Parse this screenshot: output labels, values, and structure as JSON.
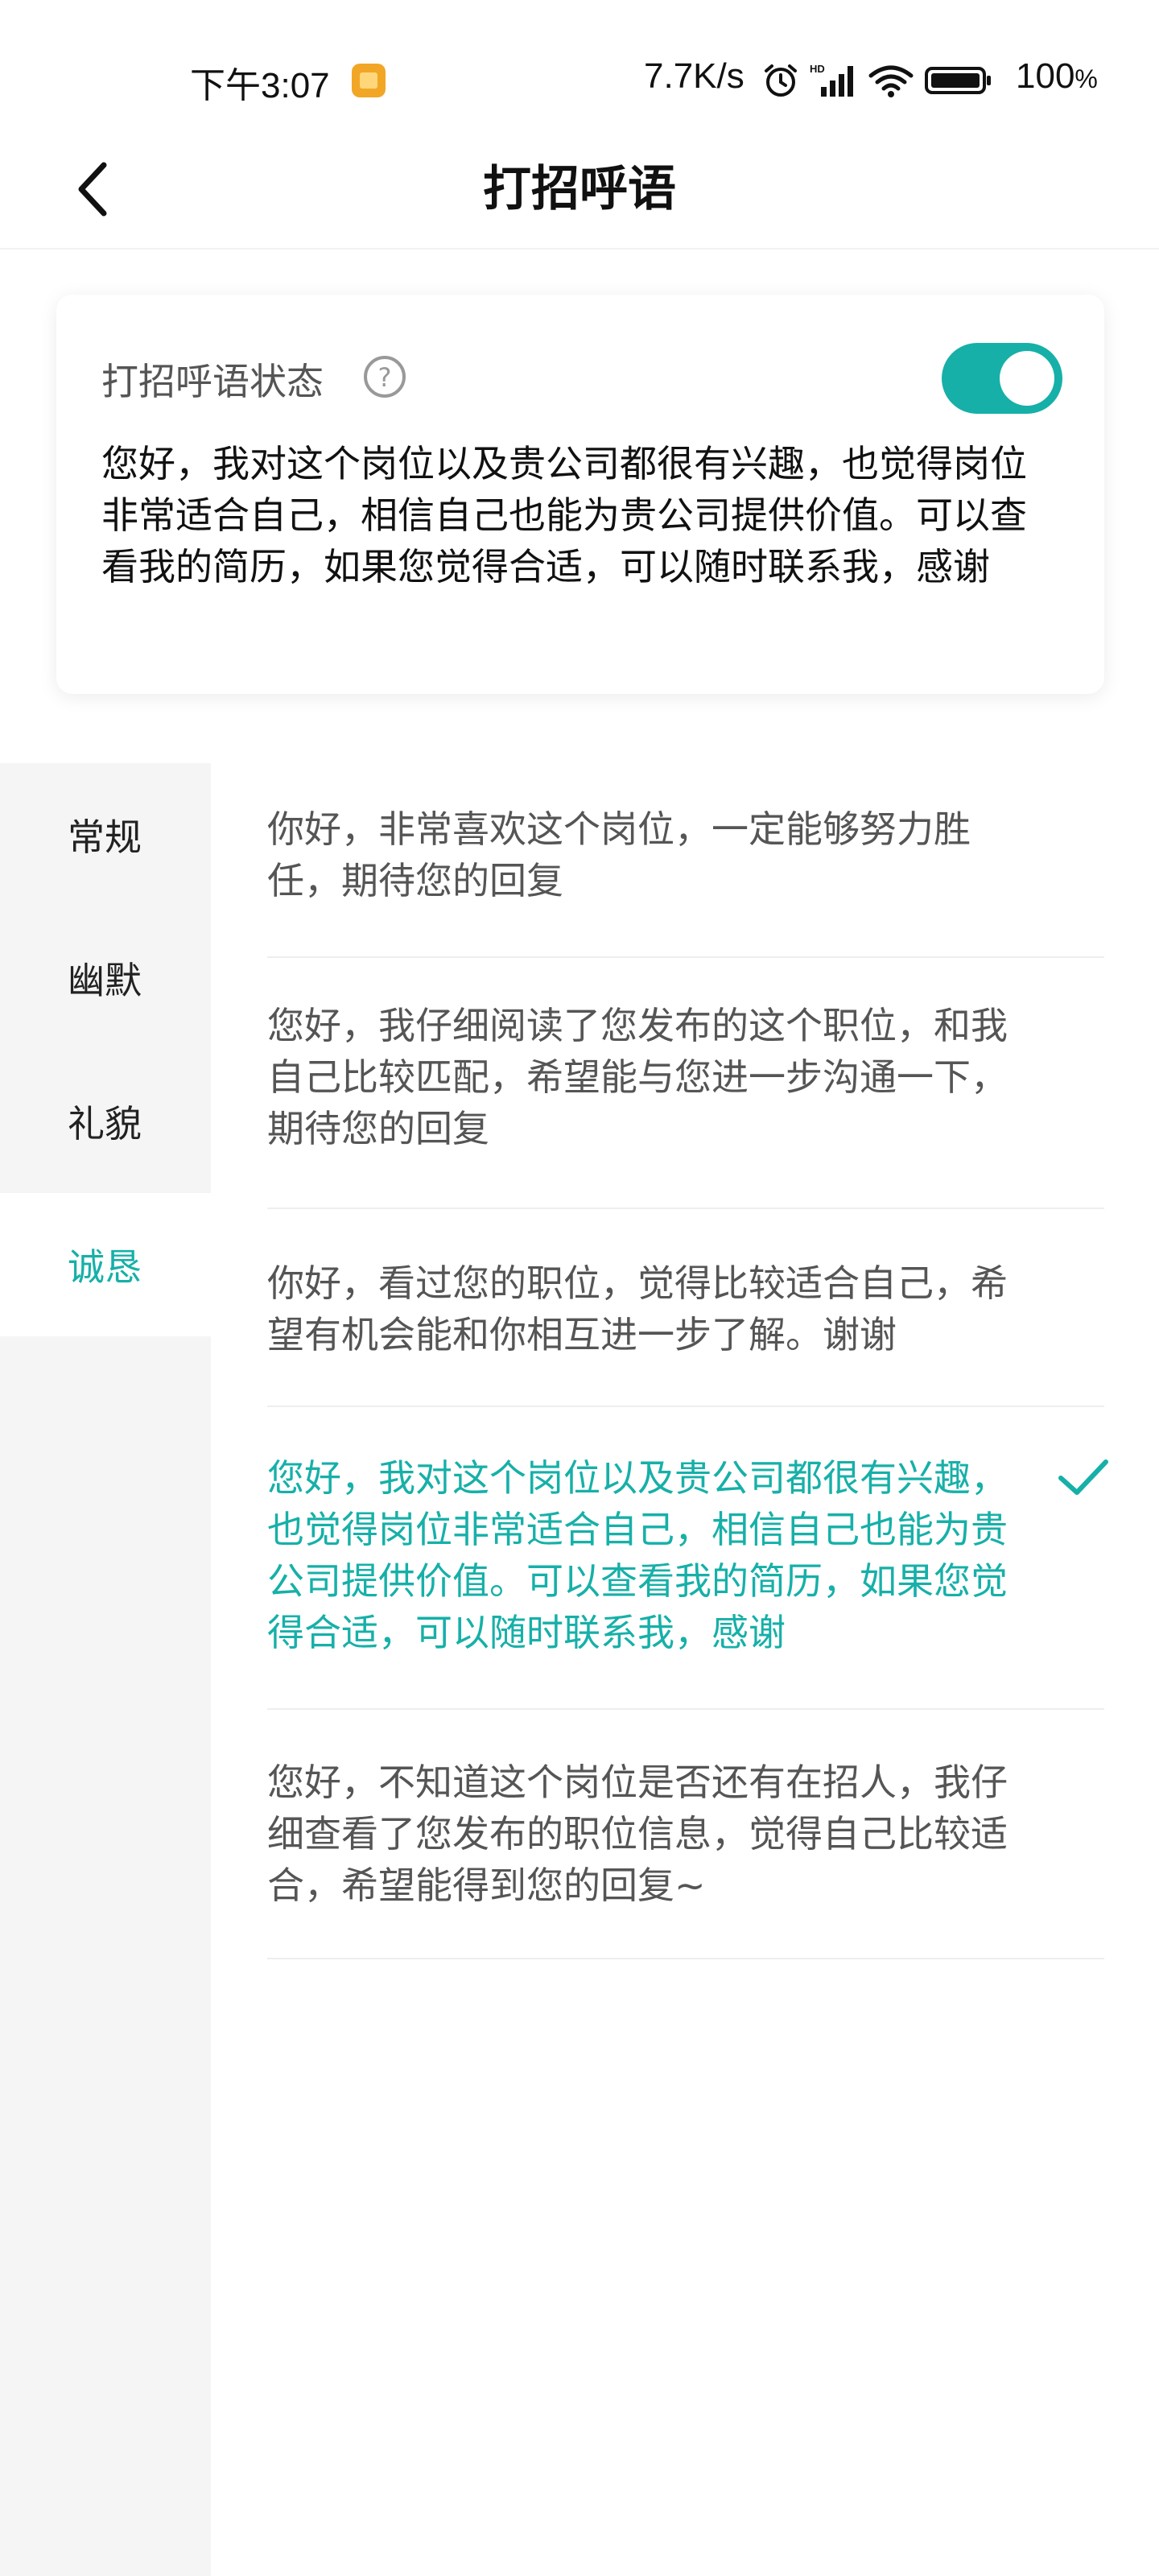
{
  "status_bar": {
    "time": "下午3:07",
    "net_speed": "7.7K/s",
    "battery": "100",
    "battery_unit": "%"
  },
  "header": {
    "title": "打招呼语"
  },
  "greeting_status": {
    "label": "打招呼语状态",
    "enabled": true,
    "current_text": "您好，我对这个岗位以及贵公司都很有兴趣，也觉得岗位非常适合自己，相信自己也能为贵公司提供价值。可以查看我的简历，如果您觉得合适，可以随时联系我，感谢"
  },
  "categories": [
    {
      "label": "常规"
    },
    {
      "label": "幽默"
    },
    {
      "label": "礼貌"
    },
    {
      "label": "诚恳",
      "active": true
    }
  ],
  "templates": [
    {
      "text": "你好，非常喜欢这个岗位，一定能够努力胜任，期待您的回复"
    },
    {
      "text": "您好，我仔细阅读了您发布的这个职位，和我自己比较匹配，希望能与您进一步沟通一下，期待您的回复"
    },
    {
      "text": "你好，看过您的职位，觉得比较适合自己，希望有机会能和你相互进一步了解。谢谢"
    },
    {
      "text": "您好，我对这个岗位以及贵公司都很有兴趣，也觉得岗位非常适合自己，相信自己也能为贵公司提供价值。可以查看我的简历，如果您觉得合适，可以随时联系我，感谢",
      "selected": true
    },
    {
      "text": "您好，不知道这个岗位是否还有在招人，我仔细查看了您发布的职位信息，觉得自己比较适合，希望能得到您的回复~"
    }
  ],
  "colors": {
    "accent": "#16b0a8",
    "sidebar_bg": "#f5f5f5",
    "text_muted": "#555555"
  },
  "icons": {
    "back": "chevron-left-icon",
    "help": "question-circle-icon",
    "check": "check-icon",
    "alarm": "alarm-icon",
    "signal": "signal-icon",
    "wifi": "wifi-icon",
    "battery": "battery-icon"
  }
}
